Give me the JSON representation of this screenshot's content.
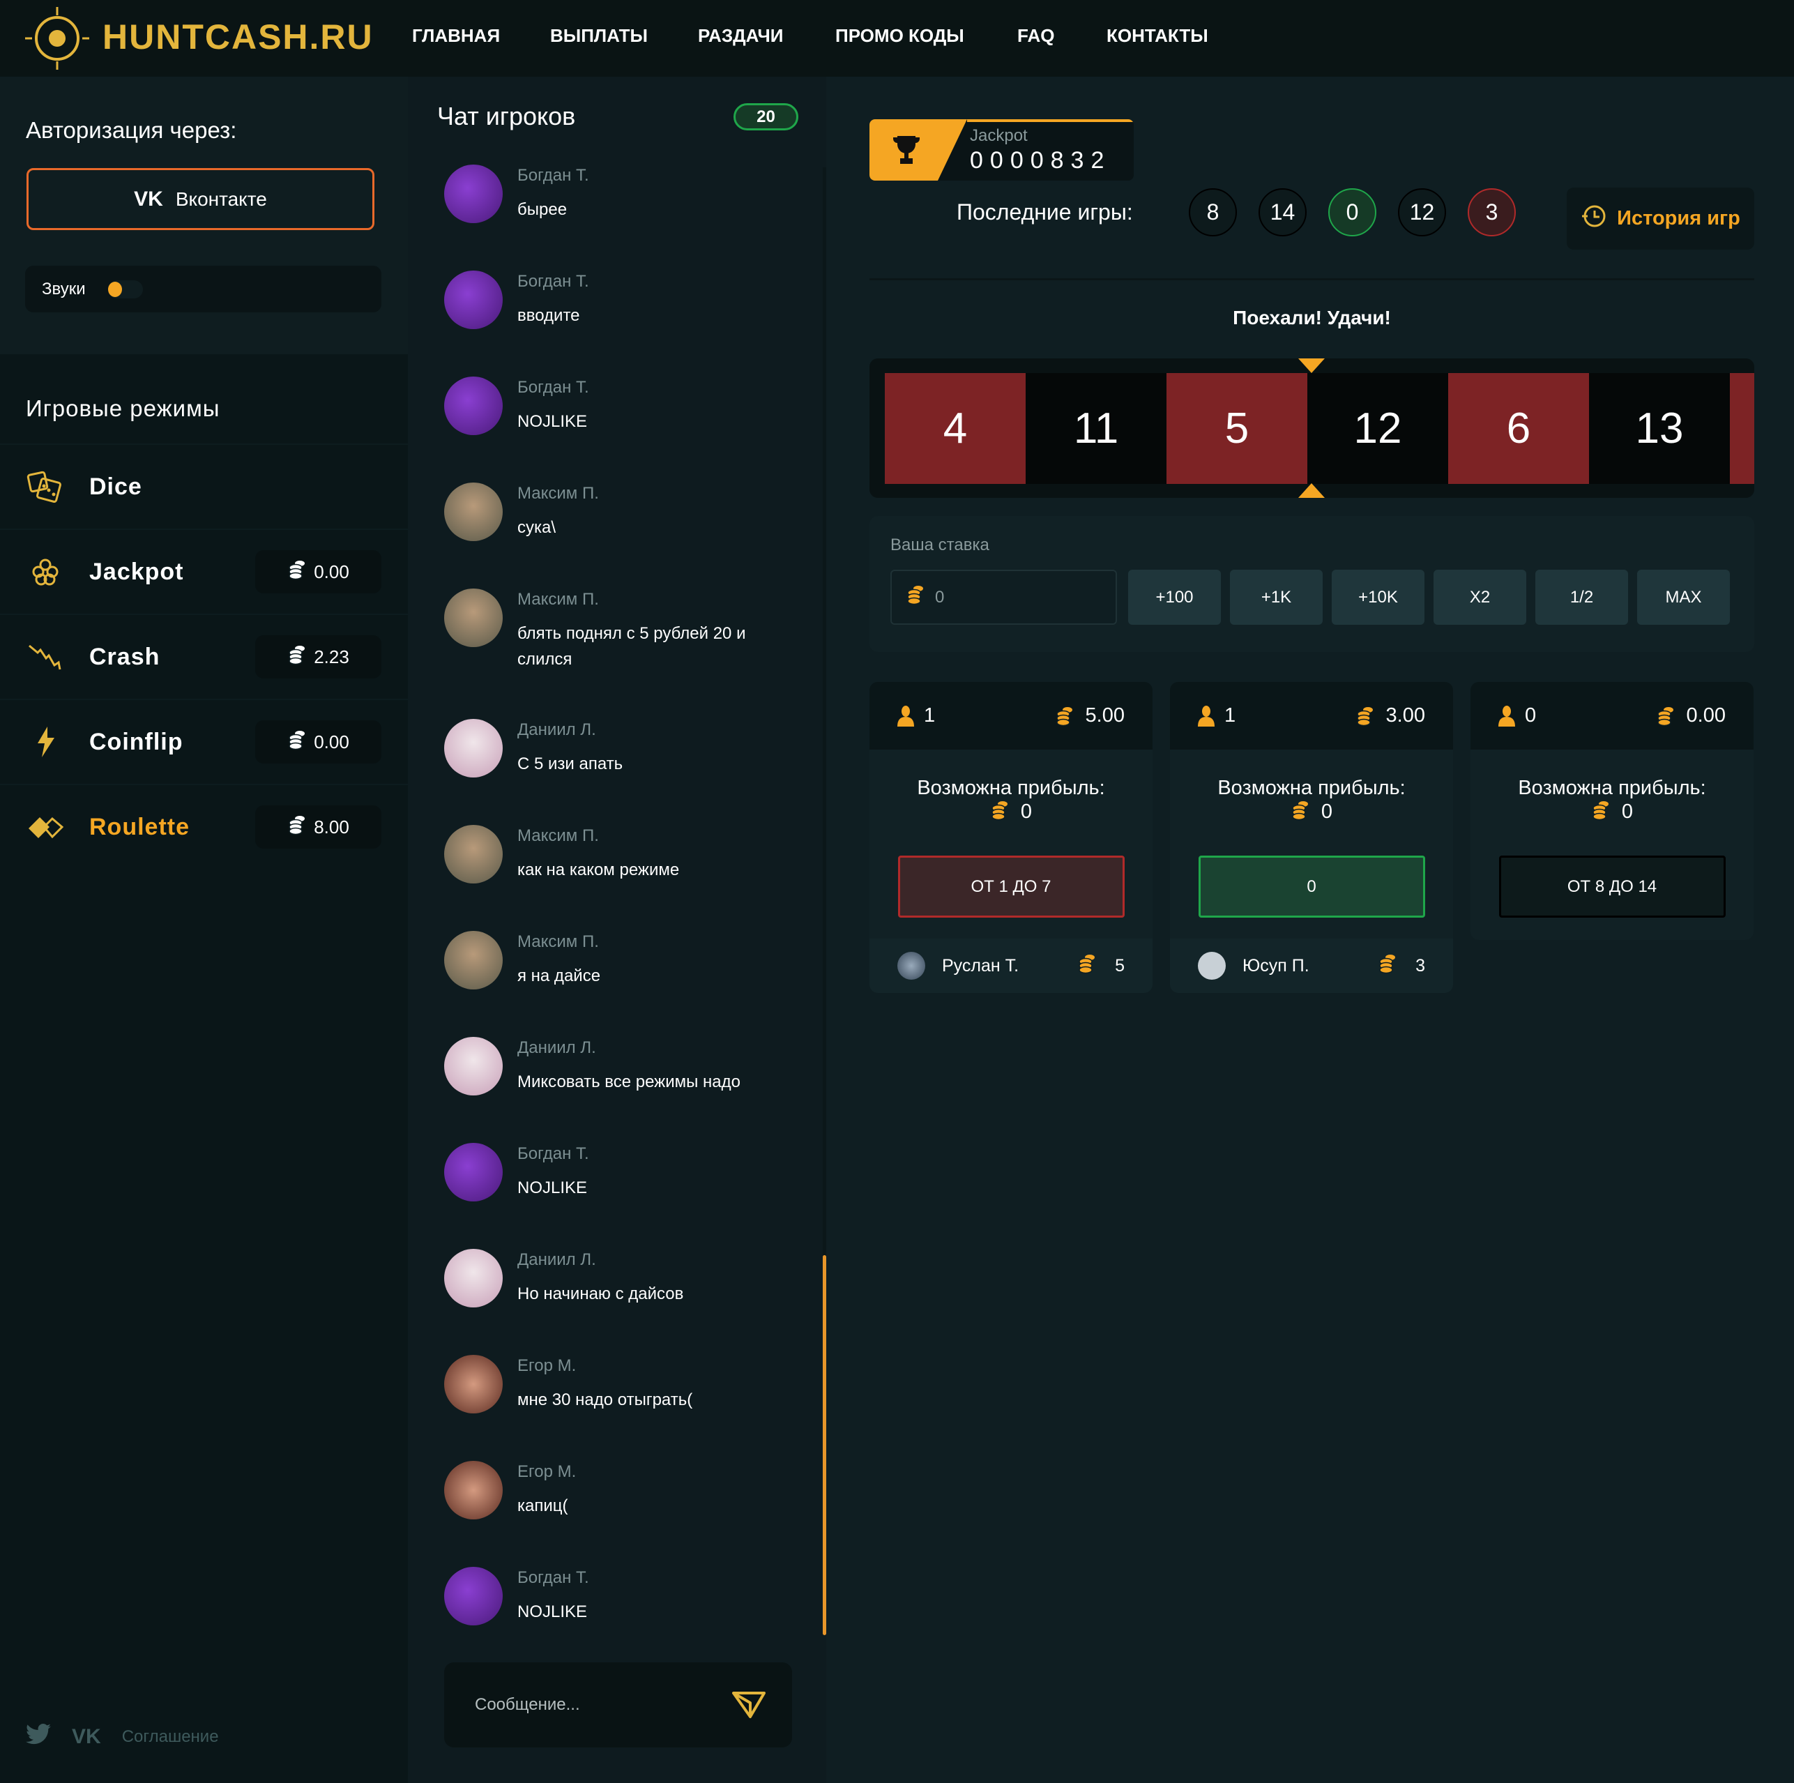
{
  "header": {
    "logo": "HUNTCASH.RU",
    "nav": [
      "ГЛАВНАЯ",
      "ВЫПЛАТЫ",
      "РАЗДАЧИ",
      "ПРОМО КОДЫ",
      "FAQ",
      "КОНТАКТЫ"
    ]
  },
  "sidebar": {
    "auth_title": "Авторизация через:",
    "vk_label": "Вконтакте",
    "sounds_label": "Звуки",
    "sounds_on": true,
    "modes_title": "Игровые режимы",
    "modes": [
      {
        "name": "Dice",
        "icon": "dice-icon",
        "amount": null,
        "active": false
      },
      {
        "name": "Jackpot",
        "icon": "jackpot-icon",
        "amount": "0.00",
        "active": false
      },
      {
        "name": "Crash",
        "icon": "crash-icon",
        "amount": "2.23",
        "active": false
      },
      {
        "name": "Coinflip",
        "icon": "lightning-icon",
        "amount": "0.00",
        "active": false
      },
      {
        "name": "Roulette",
        "icon": "roulette-icon",
        "amount": "8.00",
        "active": true
      }
    ],
    "footer_link": "Соглашение"
  },
  "chat": {
    "title": "Чат игроков",
    "online": "20",
    "placeholder": "Сообщение...",
    "messages": [
      {
        "user": "Богдан Т.",
        "text": "бырее"
      },
      {
        "user": "Богдан Т.",
        "text": "вводите"
      },
      {
        "user": "Богдан Т.",
        "text": "NOJLIKE"
      },
      {
        "user": "Максим П.",
        "text": "сука\\"
      },
      {
        "user": "Максим П.",
        "text": "блять поднял с 5 рублей 20 и слился"
      },
      {
        "user": "Даниил Л.",
        "text": "С 5 изи апать"
      },
      {
        "user": "Максим П.",
        "text": "как на каком режиме"
      },
      {
        "user": "Максим П.",
        "text": "я на дайсе"
      },
      {
        "user": "Даниил Л.",
        "text": "Миксовать все режимы надо"
      },
      {
        "user": "Богдан Т.",
        "text": "NOJLIKE"
      },
      {
        "user": "Даниил Л.",
        "text": "Но начинаю с дайсов"
      },
      {
        "user": "Егор М.",
        "text": "мне 30 надо отыграть("
      },
      {
        "user": "Егор М.",
        "text": "капиц("
      },
      {
        "user": "Богдан Т.",
        "text": "NOJLIKE"
      }
    ]
  },
  "main": {
    "jackpot_label": "Jackpot",
    "jackpot_value": "0000832",
    "last_games_label": "Последние игры:",
    "last_games": [
      {
        "n": "8",
        "color": "black"
      },
      {
        "n": "14",
        "color": "black"
      },
      {
        "n": "0",
        "color": "green"
      },
      {
        "n": "12",
        "color": "black"
      },
      {
        "n": "3",
        "color": "red"
      }
    ],
    "history_label": "История игр",
    "status": "Поехали! Удачи!",
    "roulette": [
      {
        "n": "4",
        "color": "red"
      },
      {
        "n": "11",
        "color": "black"
      },
      {
        "n": "5",
        "color": "red"
      },
      {
        "n": "12",
        "color": "black"
      },
      {
        "n": "6",
        "color": "red"
      },
      {
        "n": "13",
        "color": "black"
      },
      {
        "n": "",
        "color": "red"
      }
    ],
    "bet_label": "Ваша ставка",
    "bet_value": "0",
    "bet_buttons": [
      "+100",
      "+1K",
      "+10K",
      "X2",
      "1/2",
      "MAX"
    ],
    "cards": [
      {
        "players": "1",
        "total": "5.00",
        "profit_label": "Возможна прибыль:",
        "profit": "0",
        "button": "ОТ 1 ДО 7",
        "color": "red",
        "bets": [
          {
            "user": "Руслан Т.",
            "amount": "5"
          }
        ]
      },
      {
        "players": "1",
        "total": "3.00",
        "profit_label": "Возможна прибыль:",
        "profit": "0",
        "button": "0",
        "color": "green",
        "bets": [
          {
            "user": "Юсуп П.",
            "amount": "3"
          }
        ]
      },
      {
        "players": "0",
        "total": "0.00",
        "profit_label": "Возможна прибыль:",
        "profit": "0",
        "button": "ОТ 8 ДО 14",
        "color": "black",
        "bets": []
      }
    ]
  },
  "colors": {
    "accent": "#f5a623",
    "red": "#7d2325",
    "black": "#050808",
    "green": "#1a4331"
  }
}
